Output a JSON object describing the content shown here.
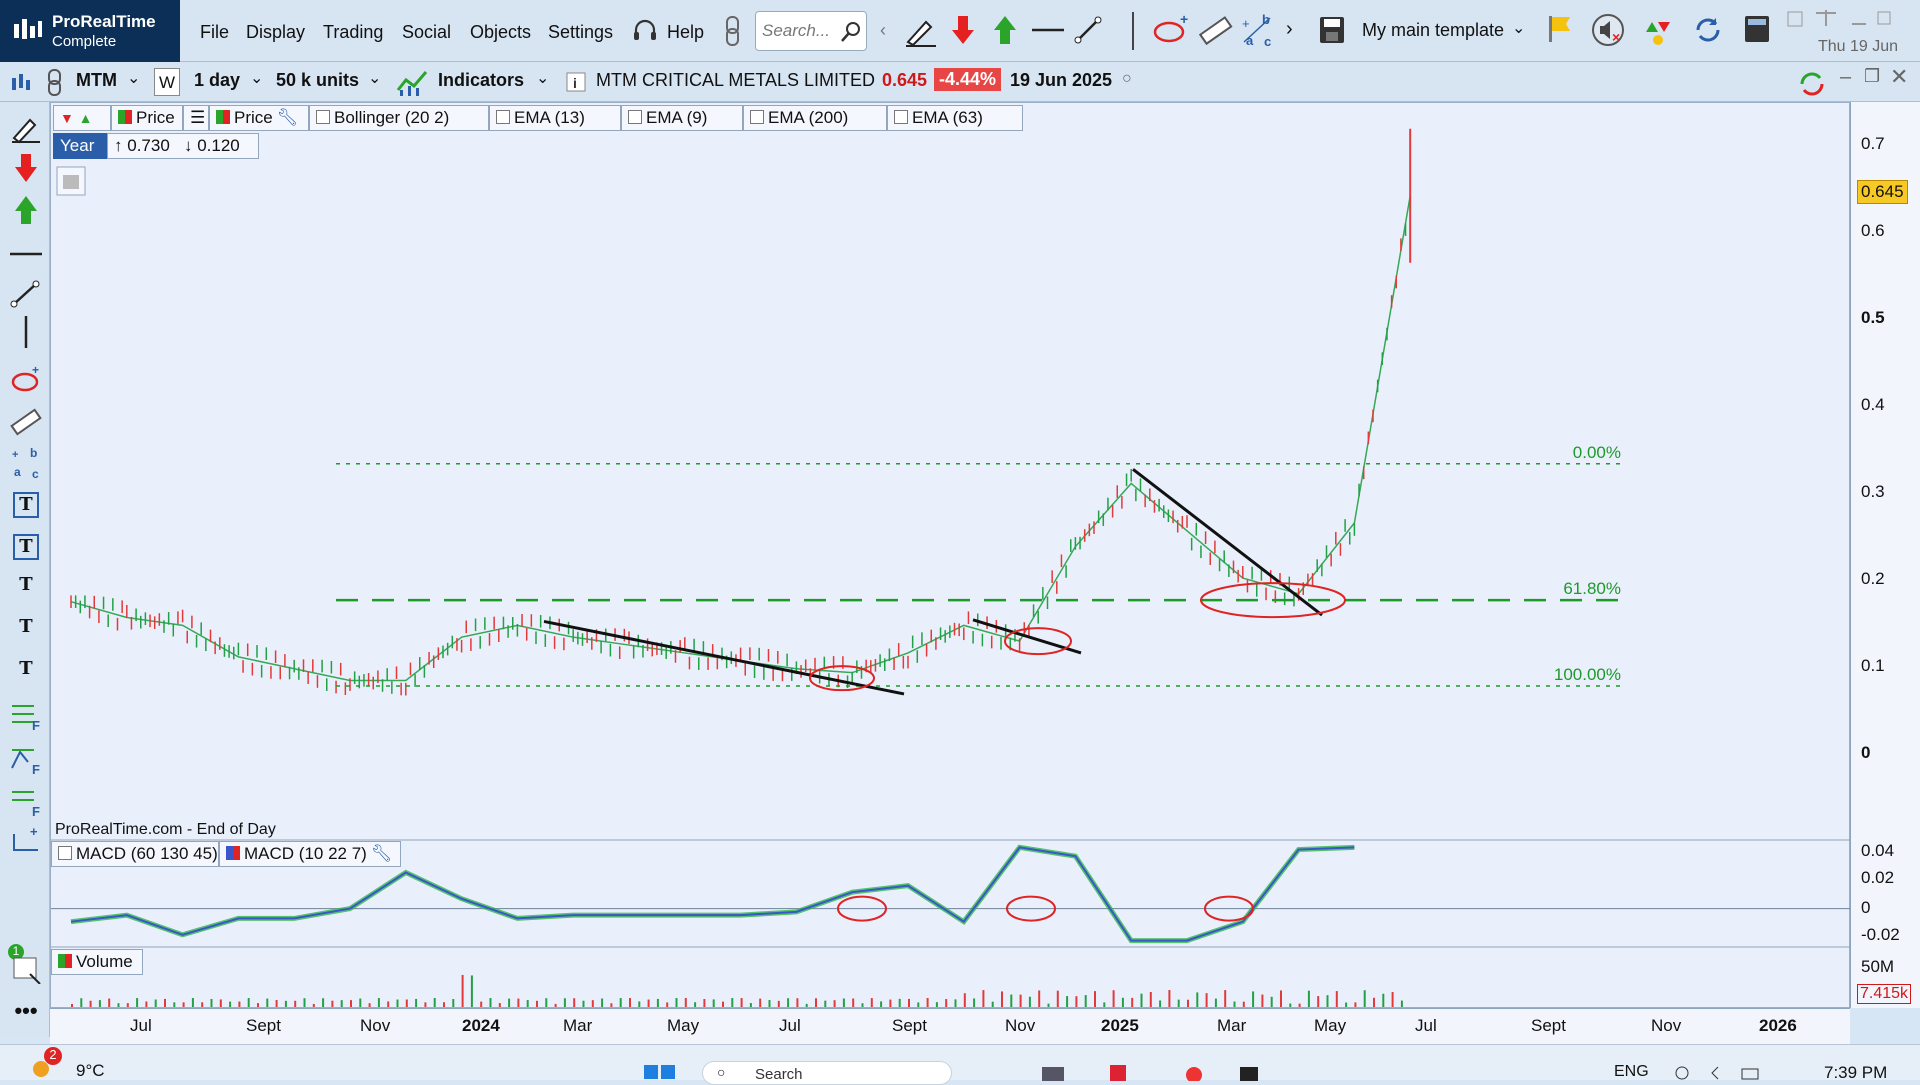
{
  "app": {
    "name": "ProRealTime",
    "edition": "Complete",
    "menu": [
      "File",
      "Display",
      "Trading",
      "Social",
      "Objects",
      "Settings"
    ],
    "help": "Help",
    "search_placeholder": "Search...",
    "template": "My main template",
    "date": "Thu 19 Jun"
  },
  "toolbar": {
    "ticker": "MTM",
    "timeframe_letter": "W",
    "period": "1 day",
    "units": "50 k units",
    "indicators": "Indicators",
    "instrument": "MTM CRITICAL METALS LIMITED",
    "last_price": "0.645",
    "change": "-4.44%",
    "bar_date": "19 Jun 2025"
  },
  "legend": {
    "price1": "Price",
    "price2": "Price",
    "indicators": [
      "Bollinger (20 2)",
      "EMA (13)",
      "EMA (9)",
      "EMA (200)",
      "EMA (63)"
    ],
    "year_label": "Year",
    "year_high": "0.730",
    "year_low": "0.120",
    "source": "ProRealTime.com - End of Day",
    "macd1": "MACD (60 130 45)",
    "macd2": "MACD (10 22 7)",
    "volume": "Volume"
  },
  "price_axis": {
    "ticks": [
      "0.7",
      "0.6",
      "0.5",
      "0.4",
      "0.3",
      "0.2",
      "0.1",
      "0"
    ],
    "current": "0.645",
    "macd_ticks": [
      "0.04",
      "0.02",
      "0",
      "-0.02"
    ],
    "volume_tick": "50M",
    "volume_current": "7.415k"
  },
  "fib_labels": [
    "0.00%",
    "61.80%",
    "100.00%"
  ],
  "time_axis": [
    "Jul",
    "Sept",
    "Nov",
    "2024",
    "Mar",
    "May",
    "Jul",
    "Sept",
    "Nov",
    "2025",
    "Mar",
    "May",
    "Jul",
    "Sept",
    "Nov",
    "2026"
  ],
  "taskbar": {
    "weather": "9°C",
    "notif": "2",
    "search": "Search",
    "lang": "ENG",
    "time": "7:39 PM",
    "panel_num": "1"
  },
  "colors": {
    "up": "#22a045",
    "down": "#e23a3a",
    "fib": "#1c9a2a",
    "circle": "#e02424",
    "macd_fill": "#2fb84b",
    "macd_line": "#3a56c8",
    "change_bg": "#e84545",
    "current_price_bg": "#f6c925"
  },
  "chart_data": {
    "type": "line",
    "title": "MTM CRITICAL METALS LIMITED",
    "x": [
      "2023-06",
      "2023-07",
      "2023-08",
      "2023-09",
      "2023-10",
      "2023-11",
      "2023-12",
      "2024-01",
      "2024-02",
      "2024-03",
      "2024-04",
      "2024-05",
      "2024-06",
      "2024-07",
      "2024-08",
      "2024-09",
      "2024-10",
      "2024-11",
      "2024-12",
      "2025-01",
      "2025-02",
      "2025-03",
      "2025-04",
      "2025-05",
      "2025-06"
    ],
    "series": [
      {
        "name": "Price",
        "values": [
          0.13,
          0.11,
          0.1,
          0.06,
          0.045,
          0.03,
          0.03,
          0.085,
          0.1,
          0.085,
          0.075,
          0.065,
          0.055,
          0.045,
          0.04,
          0.065,
          0.1,
          0.08,
          0.2,
          0.28,
          0.22,
          0.16,
          0.14,
          0.23,
          0.645
        ]
      }
    ],
    "ylim": [
      -0.1,
      0.75
    ],
    "year_high": 0.73,
    "year_low": 0.12,
    "fibonacci": [
      {
        "label": "0.00%",
        "value": 0.305
      },
      {
        "label": "61.80%",
        "value": 0.132
      },
      {
        "label": "100.00%",
        "value": 0.023
      }
    ],
    "macd_ylim": [
      -0.025,
      0.045
    ],
    "volume_tick": "50M"
  }
}
